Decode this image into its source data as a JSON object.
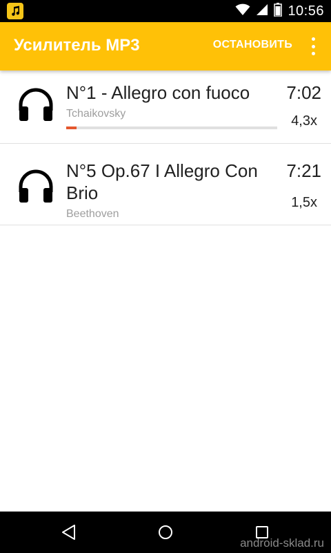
{
  "status_bar": {
    "time": "10:56",
    "icons": [
      "music-note-icon",
      "wifi-icon",
      "signal-icon",
      "battery-icon"
    ]
  },
  "app_bar": {
    "title": "Усилитель MP3",
    "stop_label": "ОСТАНОВИТЬ",
    "menu_icon": "overflow-menu-icon"
  },
  "tracks": [
    {
      "title": "N°1 - Allegro con fuoco",
      "artist": "Tchaikovsky",
      "duration": "7:02",
      "speed": "4,3x",
      "progress": 0.05,
      "icon": "headphones-icon"
    },
    {
      "title": "N°5 Op.67 I Allegro Con Brio",
      "artist": "Beethoven",
      "duration": "7:21",
      "speed": "1,5x",
      "icon": "headphones-icon"
    }
  ],
  "colors": {
    "app_bar": "#ffc107",
    "progress": "#e4572e",
    "text_primary": "#212121",
    "text_secondary": "#9e9e9e"
  },
  "watermark": "android-sklad.ru"
}
